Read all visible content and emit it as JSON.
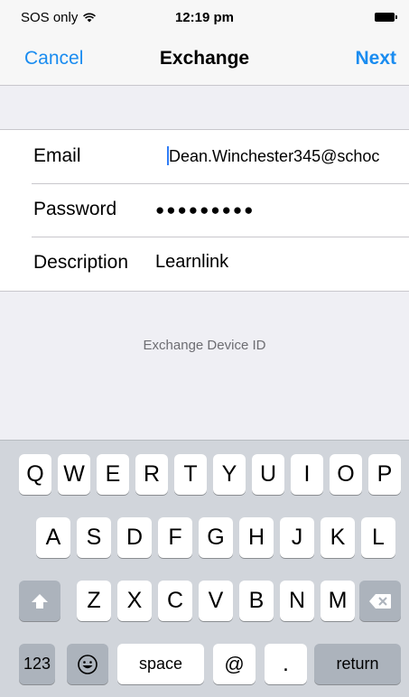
{
  "status_bar": {
    "carrier": "SOS only",
    "time": "12:19 pm"
  },
  "nav": {
    "cancel": "Cancel",
    "title": "Exchange",
    "next": "Next"
  },
  "form": {
    "email_label": "Email",
    "email_value": "Dean.Winchester345@schoc",
    "password_label": "Password",
    "password_value": "●●●●●●●●●",
    "description_label": "Description",
    "description_value": "Learnlink"
  },
  "footer_text": "Exchange Device ID",
  "keyboard": {
    "row1": [
      "Q",
      "W",
      "E",
      "R",
      "T",
      "Y",
      "U",
      "I",
      "O",
      "P"
    ],
    "row2": [
      "A",
      "S",
      "D",
      "F",
      "G",
      "H",
      "J",
      "K",
      "L"
    ],
    "row3": [
      "Z",
      "X",
      "C",
      "V",
      "B",
      "N",
      "M"
    ],
    "numbers": "123",
    "space": "space",
    "at": "@",
    "dot": ".",
    "return": "return"
  },
  "colors": {
    "accent": "#1a8cf0",
    "keyboard_bg": "#d1d5db",
    "dark_key": "#acb3bc"
  }
}
